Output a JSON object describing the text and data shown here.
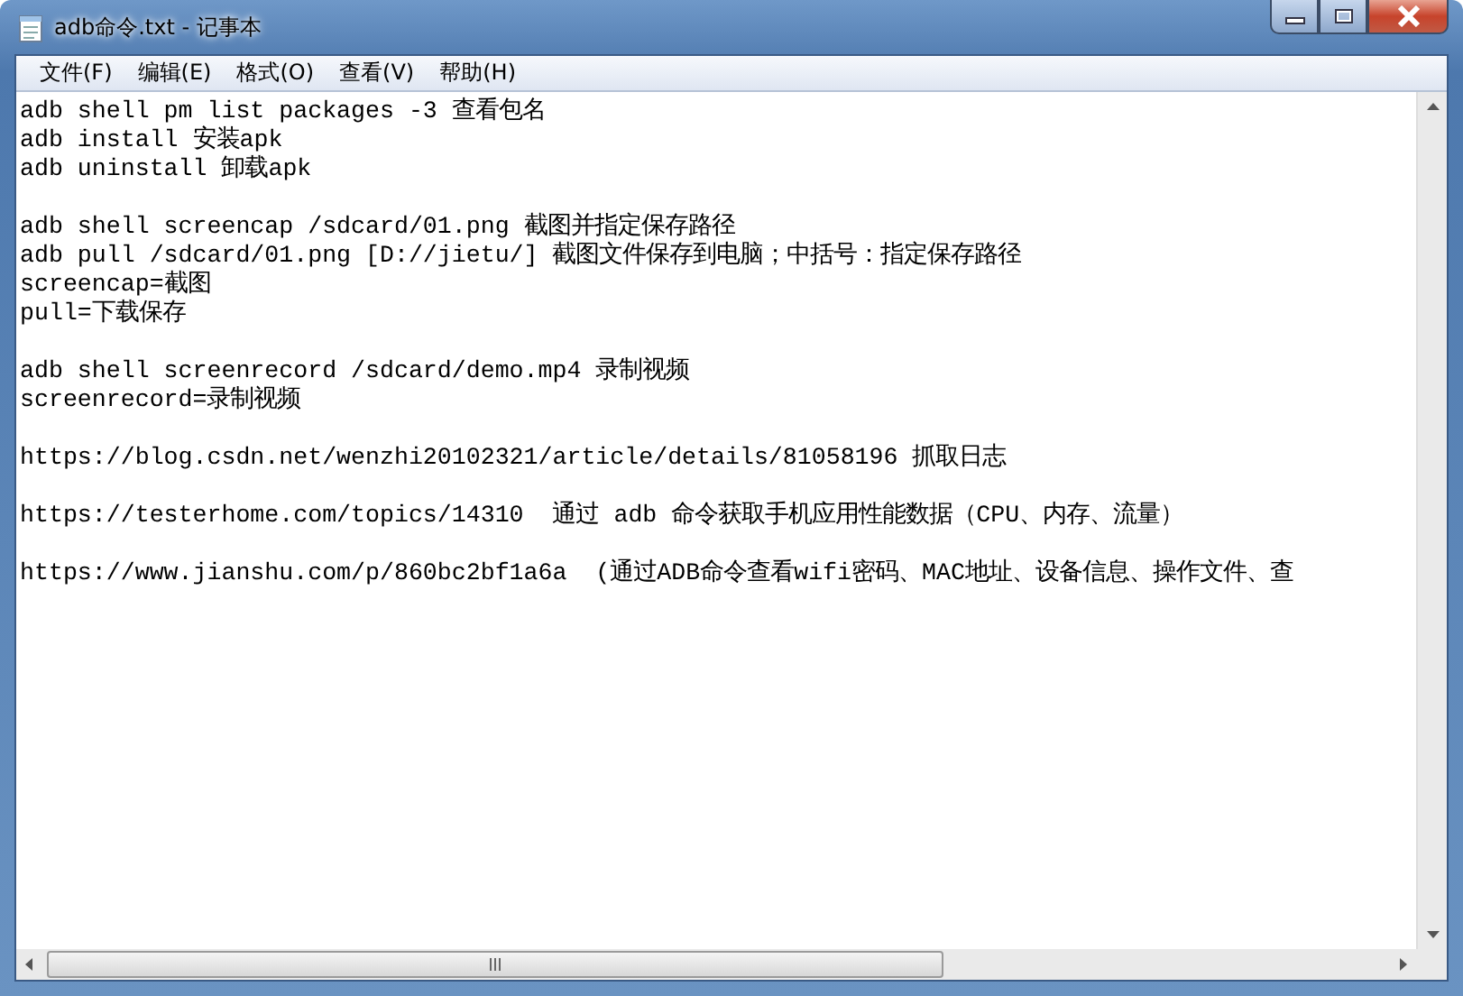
{
  "window": {
    "title": "adb命令.txt - 记事本"
  },
  "menu": [
    "文件(F)",
    "编辑(E)",
    "格式(O)",
    "查看(V)",
    "帮助(H)"
  ],
  "document": {
    "paragraphs": [
      [
        "adb shell pm list packages -3 查看包名",
        "adb install 安装apk",
        "adb uninstall 卸载apk"
      ],
      [
        "adb shell screencap /sdcard/01.png 截图并指定保存路径",
        "adb pull /sdcard/01.png [D://jietu/] 截图文件保存到电脑；中括号：指定保存路径",
        "screencap=截图",
        "pull=下载保存"
      ],
      [
        "adb shell screenrecord /sdcard/demo.mp4 录制视频",
        "screenrecord=录制视频"
      ],
      [
        "https://blog.csdn.net/wenzhi20102321/article/details/81058196 抓取日志"
      ],
      [
        "https://testerhome.com/topics/14310  通过 adb 命令获取手机应用性能数据（CPU、内存、流量）"
      ],
      [
        "https://www.jianshu.com/p/860bc2bf1a6a  (通过ADB命令查看wifi密码、MAC地址、设备信息、操作文件、查"
      ]
    ]
  }
}
